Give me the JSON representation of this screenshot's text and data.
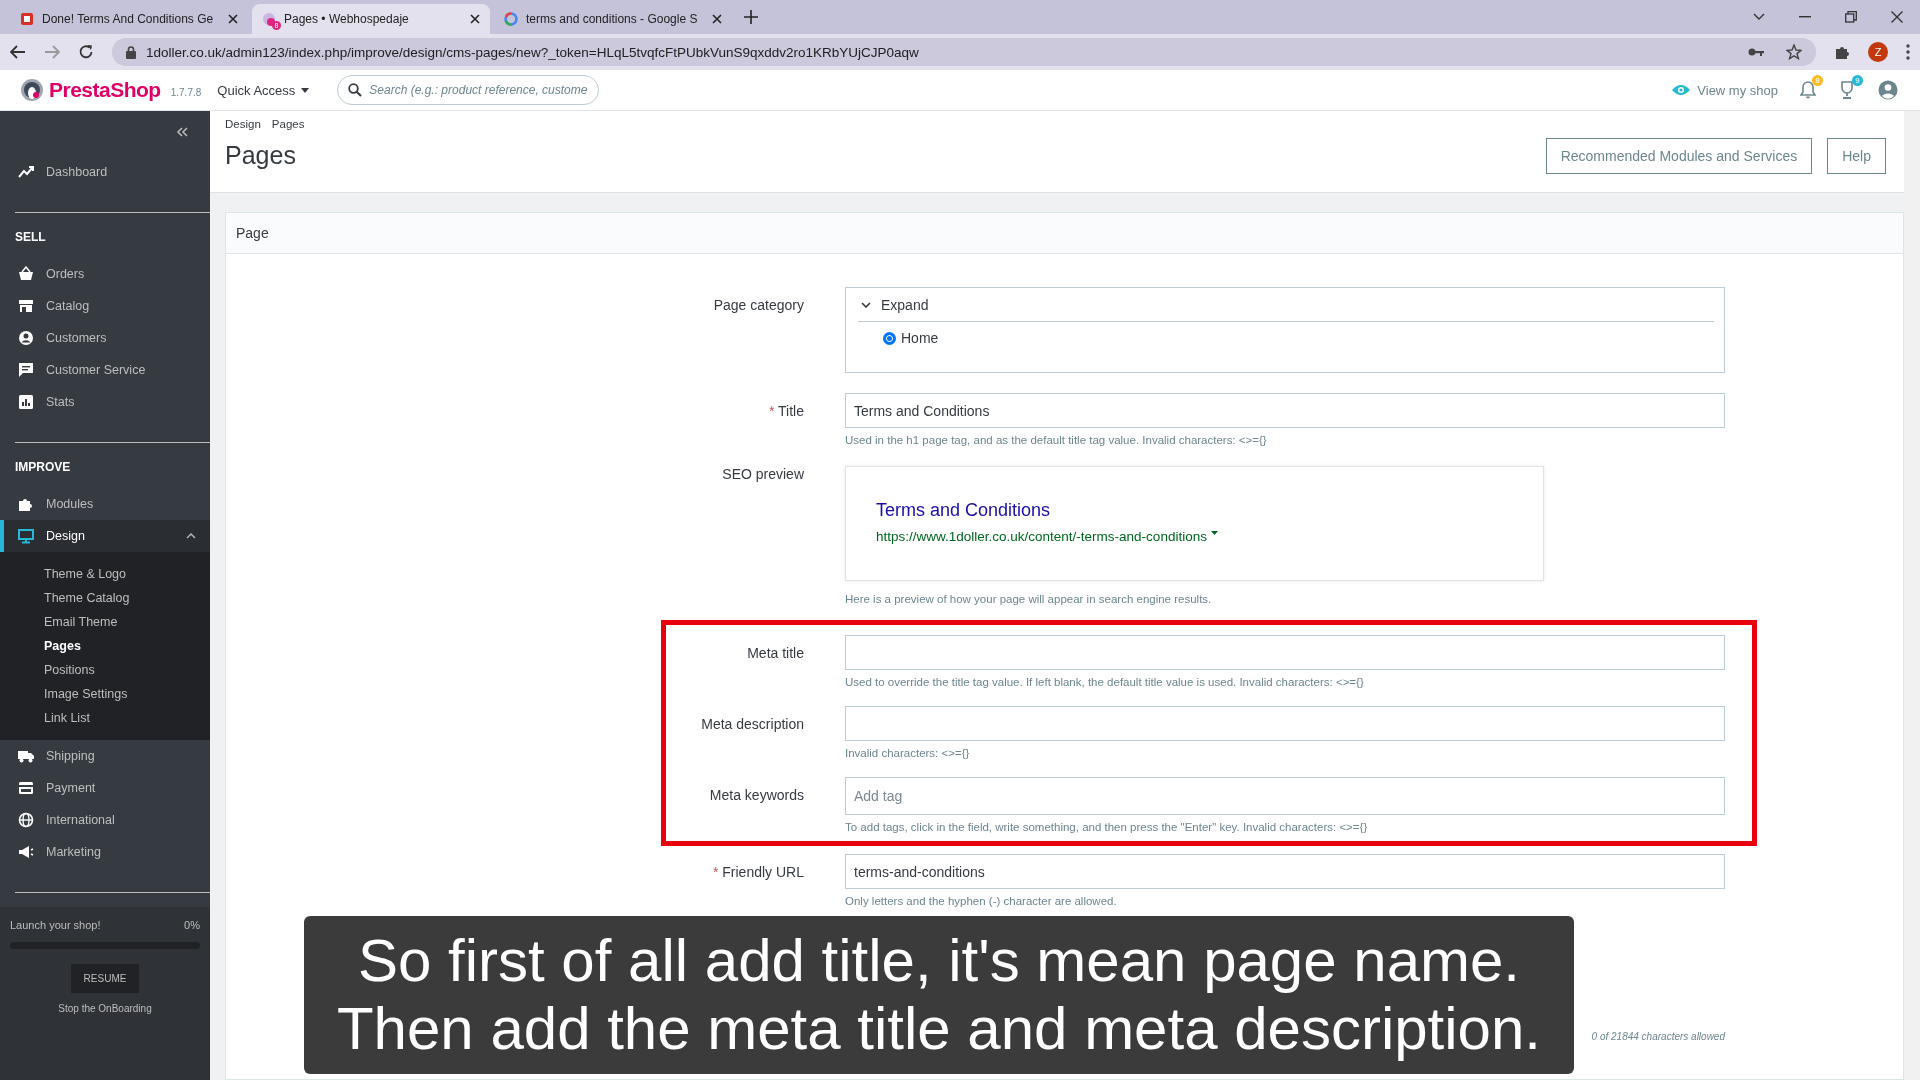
{
  "browser": {
    "tabs": [
      {
        "title": "Done! Terms And Conditions Ge",
        "selected": false,
        "kind": "doc"
      },
      {
        "title": "Pages • Webhospedaje",
        "selected": true,
        "kind": "shop",
        "badge": "8"
      },
      {
        "title": "terms and conditions - Google S",
        "selected": false,
        "kind": "google"
      }
    ],
    "url": "1doller.co.uk/admin123/index.php/improve/design/cms-pages/new?_token=HLqL5tvqfcFtPUbkVunS9qxddv2ro1KRbYUjCJP0aqw",
    "profile": "Z"
  },
  "header": {
    "logo": "PrestaShop",
    "version": "1.7.7.8",
    "quick_access": "Quick Access",
    "search": {
      "placeholder": "Search (e.g.: product reference, custome"
    },
    "view_shop": "View my shop",
    "notifications": "8",
    "achievements": "9"
  },
  "sidebar": {
    "sections": [
      {
        "items": [
          {
            "label": "Dashboard",
            "selected": false
          }
        ]
      },
      {
        "heading": "SELL",
        "items": [
          {
            "label": "Orders",
            "selected": false
          },
          {
            "label": "Catalog",
            "selected": false
          },
          {
            "label": "Customers",
            "selected": false
          },
          {
            "label": "Customer Service",
            "selected": false
          },
          {
            "label": "Stats",
            "selected": false
          }
        ]
      },
      {
        "heading": "IMPROVE",
        "items": [
          {
            "label": "Modules",
            "selected": false
          },
          {
            "label": "Design",
            "selected": true,
            "expanded": true,
            "children": [
              {
                "label": "Theme & Logo",
                "selected": false
              },
              {
                "label": "Theme Catalog",
                "selected": false
              },
              {
                "label": "Email Theme",
                "selected": false
              },
              {
                "label": "Pages",
                "selected": true
              },
              {
                "label": "Positions",
                "selected": false
              },
              {
                "label": "Image Settings",
                "selected": false
              },
              {
                "label": "Link List",
                "selected": false
              }
            ]
          },
          {
            "label": "Shipping",
            "selected": false
          },
          {
            "label": "Payment",
            "selected": false
          },
          {
            "label": "International",
            "selected": false
          },
          {
            "label": "Marketing",
            "selected": false
          }
        ]
      }
    ],
    "onboarding": {
      "title": "Launch your shop!",
      "percent": "0%",
      "level": 0,
      "button": "RESUME",
      "stop": "Stop the OnBoarding"
    }
  },
  "page": {
    "breadcrumb": [
      "Design",
      "Pages"
    ],
    "title": "Pages",
    "buttons": [
      "Recommended Modules and Services",
      "Help"
    ]
  },
  "card": {
    "title": "Page",
    "fields": [
      {
        "kind": "category",
        "label": "Page category",
        "toggle": "Expand",
        "options": [
          {
            "label": "Home",
            "selected": true
          }
        ]
      },
      {
        "kind": "text",
        "label": "Title",
        "required_mark": "*",
        "value": "Terms and Conditions",
        "hint": "Used in the h1 page tag, and as the default title tag value. Invalid characters: <>={}"
      },
      {
        "kind": "seo",
        "label": "SEO preview",
        "preview_title": "Terms and Conditions",
        "preview_url": "https://www.1doller.co.uk/content/-terms-and-conditions",
        "hint": "Here is a preview of how your page will appear in search engine results."
      }
    ],
    "highlight_box": {
      "fields": [
        {
          "kind": "text",
          "label": "Meta title",
          "hint": "Used to override the title tag value. If left blank, the default title value is used. Invalid characters: <>={}"
        },
        {
          "kind": "text",
          "label": "Meta description",
          "hint": "Invalid characters: <>={}"
        },
        {
          "kind": "tags",
          "label": "Meta keywords",
          "placeholder": "Add tag",
          "hint": "To add tags, click in the field, write something, and then press the \"Enter\" key. Invalid characters: <>={}"
        }
      ]
    },
    "fields_below": [
      {
        "kind": "text",
        "label": "Friendly URL",
        "required_mark": "*",
        "value": "terms-and-conditions",
        "hint": "Only letters and the hyphen (-) character are allowed."
      },
      {
        "kind": "editor",
        "counter": "0 of 21844 characters allowed"
      }
    ]
  },
  "subtitles": [
    "So first of all add title, it's mean page name.",
    "Then add the meta title and meta description."
  ]
}
